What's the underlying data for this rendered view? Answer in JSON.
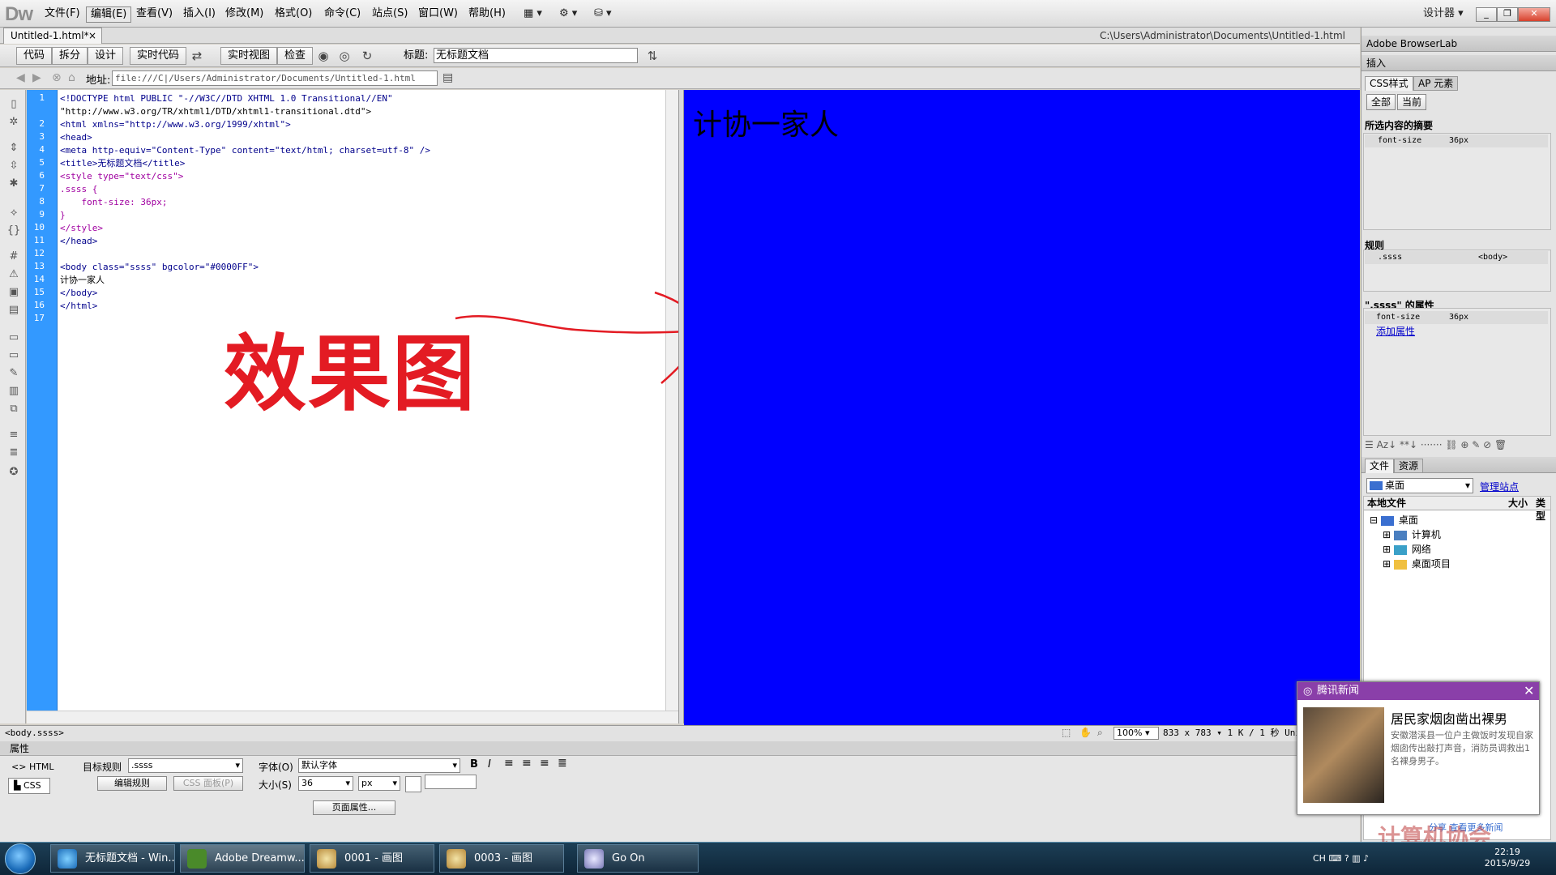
{
  "app": {
    "logo": "Dw",
    "menus": [
      "文件(F)",
      "编辑(E)",
      "查看(V)",
      "插入(I)",
      "修改(M)",
      "格式(O)",
      "命令(C)",
      "站点(S)",
      "窗口(W)",
      "帮助(H)"
    ],
    "workspace": "设计器"
  },
  "document": {
    "tab": "Untitled-1.html*",
    "path": "C:\\Users\\Administrator\\Documents\\Untitled-1.html",
    "views": [
      "代码",
      "拆分",
      "设计",
      "实时代码",
      "实时视图",
      "检查"
    ],
    "title_label": "标题:",
    "title_value": "无标题文档",
    "address_label": "地址:",
    "address_value": "file:///C|/Users/Administrator/Documents/Untitled-1.html"
  },
  "code": {
    "line_numbers": [
      "1",
      "",
      "2",
      "3",
      "4",
      "5",
      "6",
      "7",
      "8",
      "9",
      "10",
      "11",
      "12",
      "13",
      "14",
      "15",
      "16",
      "17"
    ],
    "lines": [
      "<!DOCTYPE html PUBLIC \"-//W3C//DTD XHTML 1.0 Transitional//EN\"",
      "\"http://www.w3.org/TR/xhtml1/DTD/xhtml1-transitional.dtd\">",
      "<html xmlns=\"http://www.w3.org/1999/xhtml\">",
      "<head>",
      "<meta http-equiv=\"Content-Type\" content=\"text/html; charset=utf-8\" />",
      "<title>无标题文档</title>",
      "<style type=\"text/css\">",
      ".ssss {",
      "    font-size: 36px;",
      "}",
      "</style>",
      "</head>",
      "",
      "<body class=\"ssss\" bgcolor=\"#0000FF\">",
      "计协一家人",
      "</body>",
      "</html>",
      ""
    ]
  },
  "design": {
    "background": "#0000FF",
    "text": "计协一家人"
  },
  "annotation": {
    "text": "效果图",
    "color": "#e31b23"
  },
  "status": {
    "tag_selector": "<body.ssss>",
    "zoom": "100%",
    "size": "833 x 783",
    "file_info": "1 K / 1 秒",
    "encoding": "Unic"
  },
  "properties": {
    "header": "属性",
    "html_mode": "HTML",
    "css_mode": "CSS",
    "target_rule_label": "目标规则",
    "target_rule": ".ssss",
    "edit_rule": "编辑规则",
    "css_panel": "CSS 面板(P)",
    "font_label": "字体(O)",
    "font_value": "默认字体",
    "size_label": "大小(S)",
    "size_value": "36",
    "unit": "px",
    "page_props": "页面属性..."
  },
  "panels": {
    "browserlab": "Adobe BrowserLab",
    "insert": "插入",
    "css_tab": "CSS样式",
    "ap_tab": "AP 元素",
    "all_btn": "全部",
    "current_btn": "当前",
    "summary_title": "所选内容的摘要",
    "summary_prop": "font-size",
    "summary_val": "36px",
    "rules_title": "规则",
    "rule_name": ".ssss",
    "rule_tag": "<body>",
    "props_title": "\".ssss\" 的属性",
    "prop_name": "font-size",
    "prop_val": "36px",
    "add_prop": "添加属性",
    "files_tab": "文件",
    "assets_tab": "资源",
    "site": "桌面",
    "manage_site": "管理站点",
    "col_local": "本地文件",
    "col_size": "大小",
    "col_type": "类型",
    "tree": [
      "桌面",
      "计算机",
      "网络",
      "桌面项目"
    ]
  },
  "news": {
    "source": "腾讯新闻",
    "title": "居民家烟囱凿出裸男",
    "body": "安徽潜溪县一位户主做饭时发现自家烟囱传出敲打声音，消防员调救出1名裸身男子。",
    "links": "分享      查看更多新闻"
  },
  "taskbar": {
    "items": [
      "无标题文档 - Win...",
      "Adobe Dreamw...",
      "0001 - 画图",
      "0003 - 画图",
      "Go On"
    ],
    "lang": "CH",
    "time": "22:19",
    "date": "2015/9/29"
  },
  "watermark": "计算机协会"
}
